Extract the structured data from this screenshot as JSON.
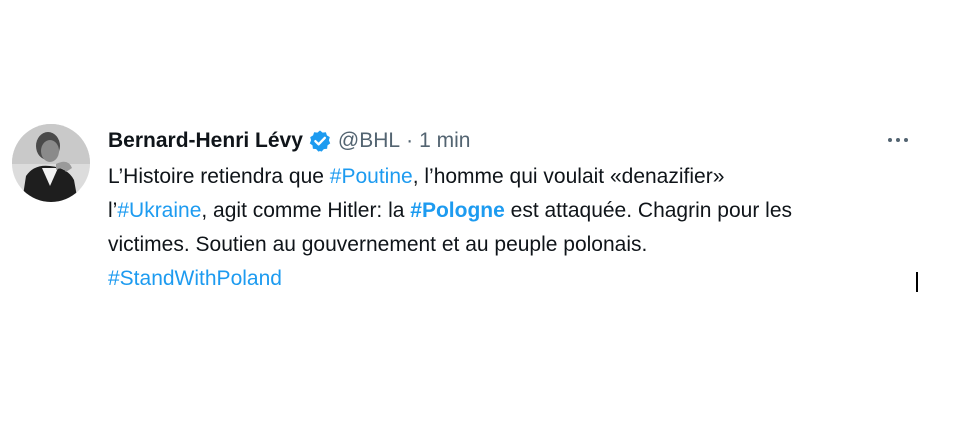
{
  "tweet": {
    "author": {
      "display_name": "Bernard-Henri Lévy",
      "handle": "@BHL",
      "verified": true
    },
    "separator": "·",
    "time": "1 min",
    "more_icon": "more-horizontal-icon",
    "text": {
      "line1_a": "L’Histoire retiendra que ",
      "tag_poutine": "#Poutine",
      "line1_b": ", l’homme qui voulait «denazifier»",
      "line2_a": "l’",
      "tag_ukraine": "#Ukraine",
      "line2_b": ", agit comme Hitler: la ",
      "tag_pologne": "#Pologne",
      "line2_c": " est attaquée. Chagrin pour les",
      "line3": "victimes. Soutien au gouvernement et au peuple polonais.",
      "tag_standwithpoland": "#StandWithPoland"
    }
  },
  "colors": {
    "text": "#0f1419",
    "muted": "#536471",
    "link": "#1d9bf0",
    "verified_badge": "#1d9bf0"
  }
}
